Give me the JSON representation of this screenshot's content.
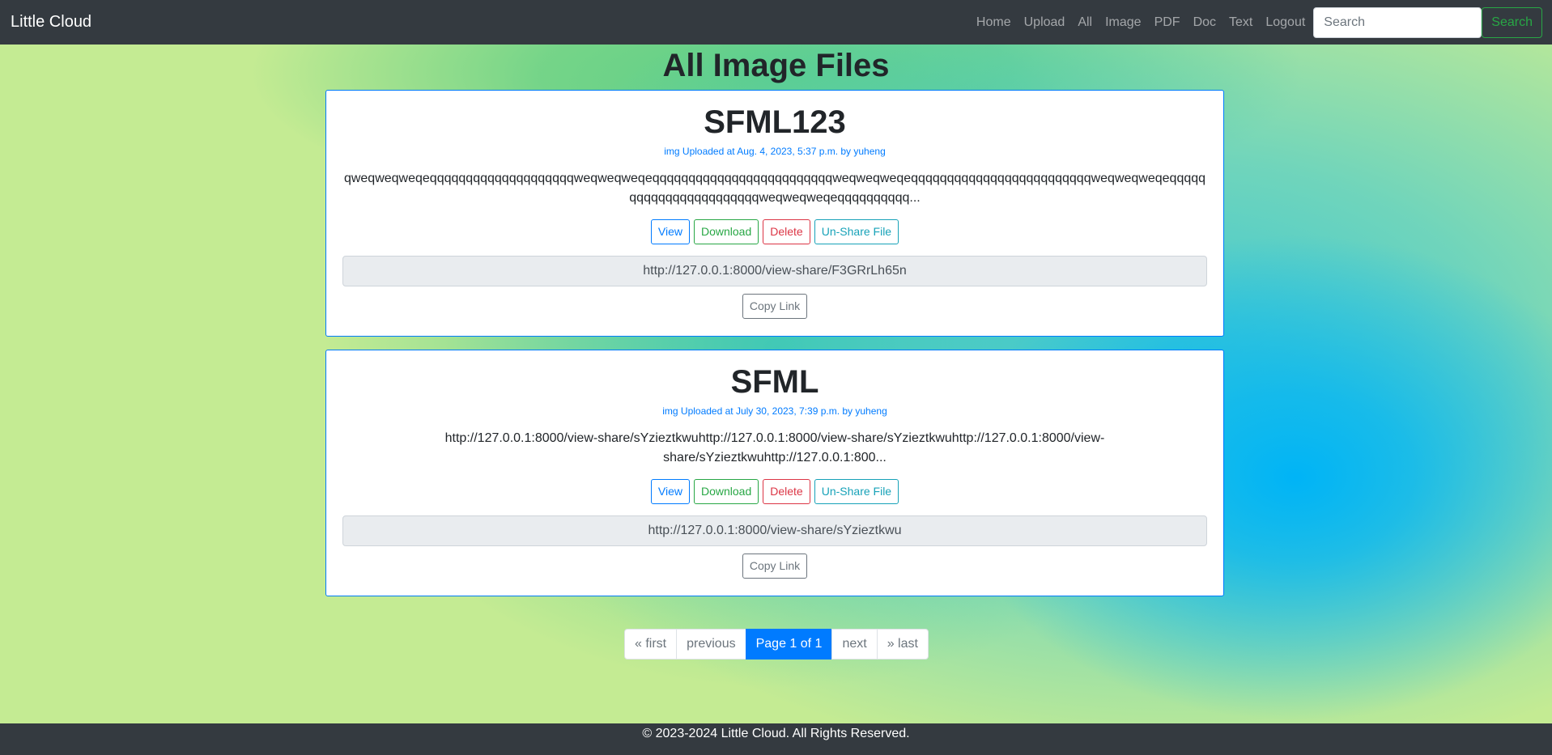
{
  "nav": {
    "brand": "Little Cloud",
    "links": [
      "Home",
      "Upload",
      "All",
      "Image",
      "PDF",
      "Doc",
      "Text",
      "Logout"
    ],
    "search_placeholder": "Search",
    "search_button": "Search"
  },
  "page_title": "All Image Files",
  "files": [
    {
      "title": "SFML123",
      "meta": "img Uploaded at Aug. 4, 2023, 5:37 p.m. by yuheng",
      "description": "qweqweqweqeqqqqqqqqqqqqqqqqqqqqweqweqweqeqqqqqqqqqqqqqqqqqqqqqqqqqweqweqweqeqqqqqqqqqqqqqqqqqqqqqqqqqweqweqweqeqqqqqqqqqqqqqqqqqqqqqqqweqweqweqeqqqqqqqqqq...",
      "buttons": {
        "view": "View",
        "download": "Download",
        "delete": "Delete",
        "unshare": "Un-Share File"
      },
      "share_link": "http://127.0.0.1:8000/view-share/F3GRrLh65n",
      "copy_label": "Copy Link"
    },
    {
      "title": "SFML",
      "meta": "img Uploaded at July 30, 2023, 7:39 p.m. by yuheng",
      "description": "http://127.0.0.1:8000/view-share/sYzieztkwuhttp://127.0.0.1:8000/view-share/sYzieztkwuhttp://127.0.0.1:8000/view-share/sYzieztkwuhttp://127.0.0.1:800...",
      "buttons": {
        "view": "View",
        "download": "Download",
        "delete": "Delete",
        "unshare": "Un-Share File"
      },
      "share_link": "http://127.0.0.1:8000/view-share/sYzieztkwu",
      "copy_label": "Copy Link"
    }
  ],
  "pagination": {
    "first": "« first",
    "previous": "previous",
    "current": "Page 1 of 1",
    "next": "next",
    "last": "» last"
  },
  "footer": "© 2023-2024 Little Cloud. All Rights Reserved.",
  "colors": {
    "navbar": "#343a40",
    "primary": "#007bff",
    "success": "#28a745",
    "danger": "#dc3545",
    "info": "#17a2b8",
    "secondary": "#6c757d"
  }
}
